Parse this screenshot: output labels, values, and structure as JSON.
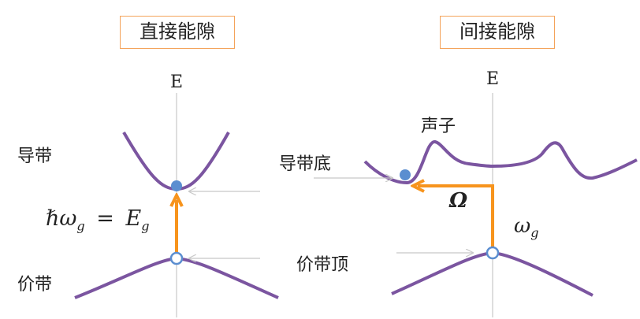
{
  "panels": {
    "direct": {
      "title": "直接能隙",
      "axis_label": "E",
      "conduction_label": "导带",
      "valence_label": "价带",
      "equation": {
        "lhs": "ℏω",
        "lhs_sub": "g",
        "eq": "=",
        "rhs": "E",
        "rhs_sub": "g"
      }
    },
    "indirect": {
      "title": "间接能隙",
      "axis_label": "E",
      "phonon_label": "声子",
      "conduction_min_label": "导带底",
      "valence_max_label": "价带顶",
      "omega_label": "Ω",
      "photon_label": "ω",
      "photon_sub": "g"
    }
  },
  "colors": {
    "band_curve": "#7b55a0",
    "transition_arrow": "#f7941d",
    "title_border": "#f4a35a",
    "electron_dot": "#5b8ed0",
    "hole_ring": "#5b8ed0",
    "axis": "#c8c8c8",
    "pointer_arrow": "#c8c8c8"
  },
  "icons": {
    "electron": "filled-circle",
    "hole": "hollow-circle"
  }
}
